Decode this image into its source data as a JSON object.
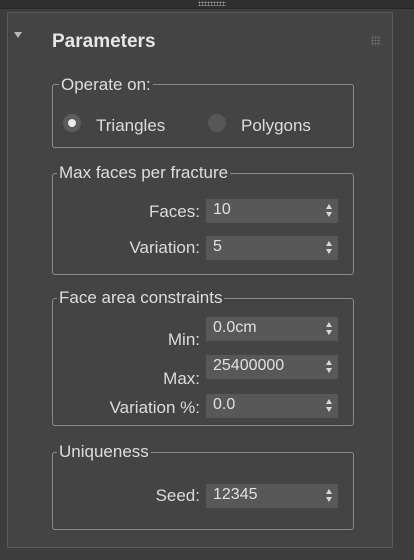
{
  "rollout": {
    "title": "Parameters"
  },
  "operate_on": {
    "label": "Operate on:",
    "options": [
      "Triangles",
      "Polygons"
    ],
    "selected": "Triangles"
  },
  "max_faces": {
    "label": "Max faces per fracture",
    "faces_label": "Faces:",
    "faces_value": "10",
    "variation_label": "Variation:",
    "variation_value": "5"
  },
  "face_area": {
    "label": "Face area constraints",
    "min_label": "Min:",
    "min_value": "0.0cm",
    "max_label": "Max:",
    "max_value": "25400000",
    "variation_label": "Variation %:",
    "variation_value": "0.0"
  },
  "uniqueness": {
    "label": "Uniqueness",
    "seed_label": "Seed:",
    "seed_value": "12345"
  }
}
